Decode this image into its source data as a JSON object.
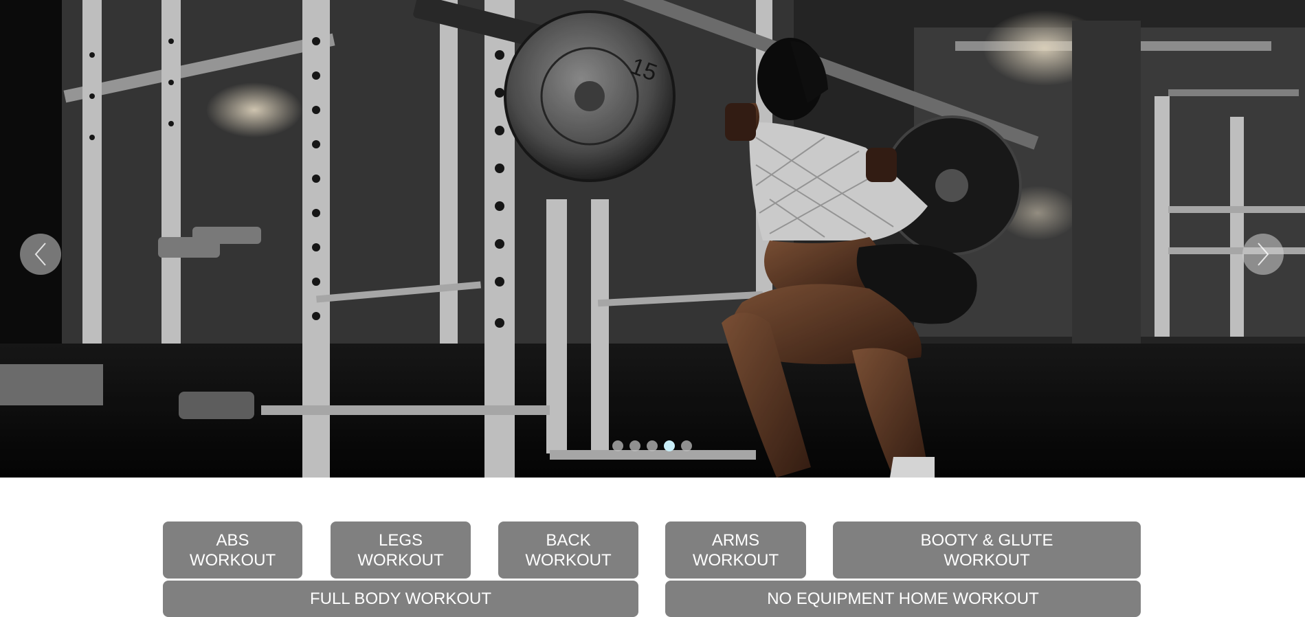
{
  "slider": {
    "prev_icon": "chevron-left-icon",
    "next_icon": "chevron-right-icon",
    "dots": [
      {
        "active": false
      },
      {
        "active": false
      },
      {
        "active": false
      },
      {
        "active": true
      },
      {
        "active": false
      }
    ],
    "active_dot_color": "#c9eef8",
    "plate_label": "15"
  },
  "workouts": {
    "abs": {
      "line1": "ABS",
      "line2": "WORKOUT"
    },
    "legs": {
      "line1": "LEGS",
      "line2": "WORKOUT"
    },
    "back": {
      "line1": "BACK",
      "line2": "WORKOUT"
    },
    "arms": {
      "line1": "ARMS",
      "line2": "WORKOUT"
    },
    "booty": {
      "line1": "BOOTY & GLUTE",
      "line2": "WORKOUT"
    },
    "full_body": "FULL BODY WORKOUT",
    "no_equipment": "NO EQUIPMENT HOME WORKOUT"
  },
  "colors": {
    "button_bg": "#808080",
    "button_text": "#ffffff"
  }
}
